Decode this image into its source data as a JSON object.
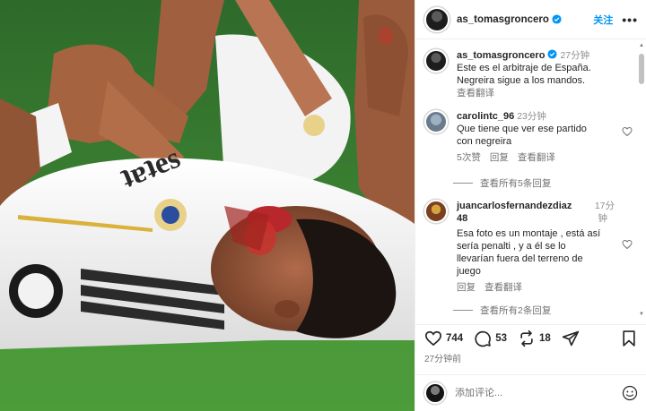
{
  "header": {
    "username": "as_tomasgroncero",
    "follow_label": "关注",
    "more_label": "•••"
  },
  "caption": {
    "username": "as_tomasgroncero",
    "time": "27分钟",
    "text_line1": "Este es el arbitraje de España.",
    "text_line2": "Negreira sigue a los mandos.",
    "translate": "查看翻译"
  },
  "comments": [
    {
      "username": "carolintc_96",
      "time": "23分钟",
      "text_line1": "Que tiene que ver ese partido",
      "text_line2": "con negreira",
      "likes": "5次赞",
      "reply": "回复",
      "translate": "查看翻译",
      "view_replies": "查看所有5条回复"
    },
    {
      "username": "juancarlosfernandezdiaz",
      "username_tail": "48",
      "time_line1": "17分",
      "time_line2": "钟",
      "text_line1": "Esa foto es un montaje , está así",
      "text_line2": "sería penalti , y a él se lo",
      "text_line3": "llevarían fuera del terreno de",
      "text_line4": "juego",
      "reply": "回复",
      "translate": "查看翻译",
      "view_replies": "查看所有2条回复"
    }
  ],
  "stats": {
    "likes": "744",
    "comments": "53",
    "reposts": "18"
  },
  "posted_ago": "27分钟前",
  "add_comment": {
    "placeholder": "添加评论..."
  },
  "icons": {
    "verified": "verified-badge-icon",
    "like": "heart-icon",
    "comment": "comment-bubble-icon",
    "repost": "repost-icon",
    "share": "paper-plane-icon",
    "save": "bookmark-icon",
    "emoji": "smiley-icon"
  },
  "colors": {
    "verified_blue": "#0095f6",
    "follow_blue": "#0095f6",
    "muted_text": "#737373"
  }
}
